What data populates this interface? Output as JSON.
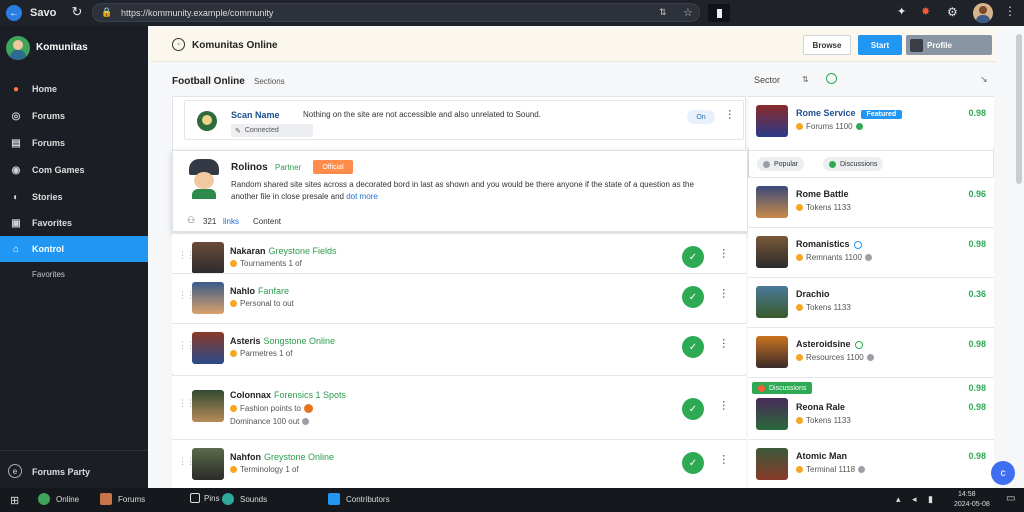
{
  "topbar": {
    "title": "Savo",
    "url": "https://kommunity.example/community",
    "icons": [
      "back-icon",
      "refresh-icon",
      "lock-icon",
      "share-icon",
      "star-icon",
      "bookmark-icon",
      "extensions-icon",
      "notification-icon",
      "settings-icon"
    ]
  },
  "sidebar": {
    "brand": "Komunitas",
    "items": [
      {
        "label": "Home",
        "icon": "home-icon"
      },
      {
        "label": "Forums",
        "icon": "forum-icon"
      },
      {
        "label": "Forums",
        "icon": "list-icon"
      },
      {
        "label": "Com Games",
        "icon": "game-icon"
      },
      {
        "label": "Stories",
        "icon": "story-icon"
      },
      {
        "label": "Favorites",
        "icon": "favorite-icon"
      },
      {
        "label": "Kontrol",
        "icon": "home-icon"
      }
    ],
    "subitem": "Favorites",
    "footer": "Forums Party"
  },
  "header": {
    "title": "Komunitas Online",
    "btn_secondary": "Browse",
    "btn_primary": "Start",
    "btn_user": "Profile"
  },
  "section": {
    "title": "Football Online",
    "subtitle": "Sections",
    "right_label": "Sector"
  },
  "composer": {
    "name": "Scan Name",
    "text": "Nothing on the site are not accessible and also unrelated to Sound.",
    "chip": "Connected",
    "toggle": "On"
  },
  "popup": {
    "name": "Rolinos",
    "tag": "Partner",
    "badge": "Official",
    "text": "Random shared site sites across a decorated bord in last as shown and you would be there anyone if the state of a question as the",
    "link": "dot more",
    "text2": "another file in close presale and",
    "footer_count": "321",
    "footer_link": "links",
    "footer_text": "Content"
  },
  "rows": [
    {
      "name": "Nakaran",
      "tag": "Greystone Fields",
      "sub": "Tournaments 1 of"
    },
    {
      "name": "Nahlo",
      "tag": "Fanfare",
      "sub": "Personal to out"
    },
    {
      "name": "Asteris",
      "tag": "Songstone Online",
      "sub": "Parmetres 1 of"
    },
    {
      "name": "Colonnax",
      "tag": "Forensics 1 Spots",
      "sub": "Fashion points to",
      "sub2": "Dominance 100 out"
    },
    {
      "name": "Nahfon",
      "tag": "Greystone Online",
      "sub": "Terminology 1 of"
    }
  ],
  "right": {
    "top": {
      "name": "Rome Service",
      "badge": "Featured",
      "sub": "Forums 1100",
      "val": "0.98"
    },
    "chips": [
      "Popular",
      "Discussions"
    ],
    "rows": [
      {
        "name": "Rome Battle",
        "sub": "Tokens 1133",
        "val": "0.96"
      },
      {
        "name": "Romanistics",
        "sub": "Remnants 1100",
        "val": "0.98"
      },
      {
        "name": "Drachio",
        "sub": "Tokens 1133",
        "val": "0.36"
      },
      {
        "name": "Asteroidsine",
        "sub": "Resources 1100",
        "val": "0.98"
      },
      {
        "name": "Reona Rale",
        "sub": "Tokens 1133",
        "val": "0.98",
        "chip": "Discussions",
        "chip_val": "0.98"
      },
      {
        "name": "Atomic Man",
        "sub": "Terminal 1118",
        "val": "0.98"
      }
    ]
  },
  "taskbar": {
    "items": [
      "Online",
      "Forums",
      "Pins",
      "Sounds",
      "Contributors"
    ],
    "time": "14:58",
    "date": "2024-05-08"
  },
  "colors": {
    "accent": "#2196f3",
    "green": "#2eaa55",
    "orange": "#f5a623",
    "dark": "#1b1f25"
  }
}
